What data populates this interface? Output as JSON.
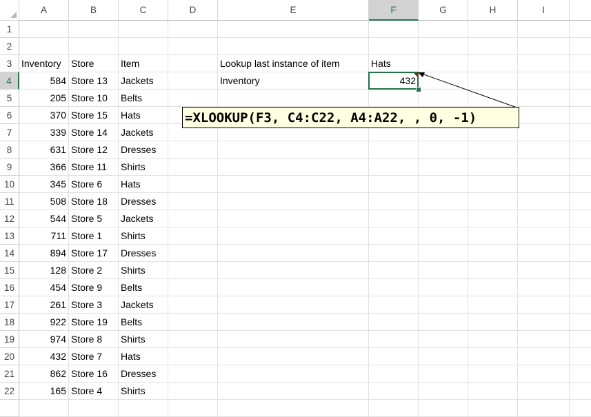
{
  "sheet": {
    "column_headers": [
      "A",
      "B",
      "C",
      "D",
      "E",
      "F",
      "G",
      "H",
      "I"
    ],
    "row_headers": [
      "1",
      "2",
      "3",
      "4",
      "5",
      "6",
      "7",
      "8",
      "9",
      "10",
      "11",
      "12",
      "13",
      "14",
      "15",
      "16",
      "17",
      "18",
      "19",
      "20",
      "21",
      "22"
    ],
    "active_cell": "F4",
    "header_row": {
      "a": "Inventory",
      "b": "Store",
      "c": "Item"
    },
    "rows": [
      {
        "inventory": "584",
        "store": "Store 13",
        "item": "Jackets"
      },
      {
        "inventory": "205",
        "store": "Store 10",
        "item": "Belts"
      },
      {
        "inventory": "370",
        "store": "Store 15",
        "item": "Hats"
      },
      {
        "inventory": "339",
        "store": "Store 14",
        "item": "Jackets"
      },
      {
        "inventory": "631",
        "store": "Store 12",
        "item": "Dresses"
      },
      {
        "inventory": "366",
        "store": "Store 11",
        "item": "Shirts"
      },
      {
        "inventory": "345",
        "store": "Store 6",
        "item": "Hats"
      },
      {
        "inventory": "508",
        "store": "Store 18",
        "item": "Dresses"
      },
      {
        "inventory": "544",
        "store": "Store 5",
        "item": "Jackets"
      },
      {
        "inventory": "711",
        "store": "Store 1",
        "item": "Shirts"
      },
      {
        "inventory": "894",
        "store": "Store 17",
        "item": "Dresses"
      },
      {
        "inventory": "128",
        "store": "Store 2",
        "item": "Shirts"
      },
      {
        "inventory": "454",
        "store": "Store 9",
        "item": "Belts"
      },
      {
        "inventory": "261",
        "store": "Store 3",
        "item": "Jackets"
      },
      {
        "inventory": "922",
        "store": "Store 19",
        "item": "Belts"
      },
      {
        "inventory": "974",
        "store": "Store 8",
        "item": "Shirts"
      },
      {
        "inventory": "432",
        "store": "Store 7",
        "item": "Hats"
      },
      {
        "inventory": "862",
        "store": "Store 16",
        "item": "Dresses"
      },
      {
        "inventory": "165",
        "store": "Store 4",
        "item": "Shirts"
      }
    ],
    "lookup": {
      "label": "Lookup last instance of item",
      "criteria": "Hats",
      "result_label": "Inventory",
      "result_value": "432"
    }
  },
  "comment": {
    "text": "=XLOOKUP(F3, C4:C22, A4:A22, , 0, -1)"
  },
  "colors": {
    "accent": "#217346",
    "comment_bg": "#ffffe1",
    "comment_marker": "#c00000"
  }
}
